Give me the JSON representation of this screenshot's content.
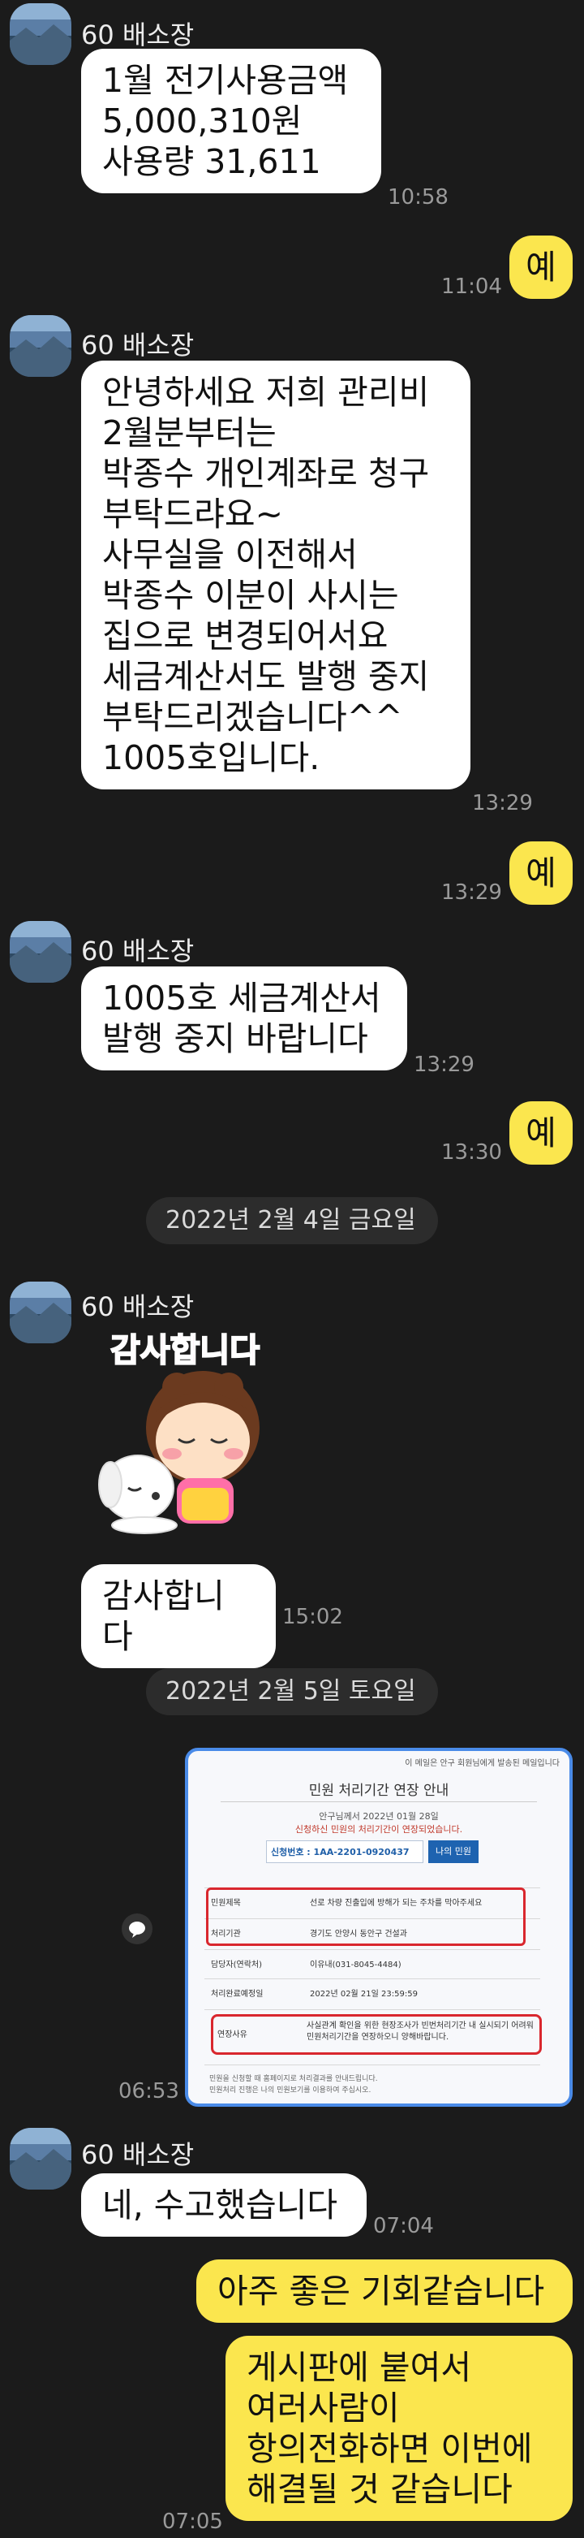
{
  "sender": "60 배소장",
  "messages": [
    {
      "text": "1월 전기사용금액\n5,000,310원\n사용량 31,611",
      "time": "10:58"
    },
    {
      "text": "예",
      "time": "11:04"
    },
    {
      "text": "안녕하세요 저희 관리비\n2월분부터는\n박종수 개인계좌로 청구\n부탁드랴요~\n사무실을 이전해서\n박종수 이분이 사시는\n집으로 변경되어서요\n세금계산서도 발행 중지\n부탁드리겠습니다^^\n1005호입니다.",
      "time": "13:29"
    },
    {
      "text": "예",
      "time": "13:29"
    },
    {
      "text": "1005호 세금계산서\n발행 중지 바랍니다",
      "time": "13:29"
    },
    {
      "text": "예",
      "time": "13:30"
    },
    {
      "text": "감사합니다",
      "time": "15:02"
    },
    {
      "text": "네,  수고했습니다",
      "time": "07:04"
    },
    {
      "text": "아주 좋은 기회같습니다",
      "time": ""
    },
    {
      "text": "게시판에 붙여서\n여러사람이\n항의전화하면 이번에\n해결될 것 같습니다",
      "time": "07:05"
    }
  ],
  "dates": [
    "2022년 2월 4일 금요일",
    "2022년 2월 5일 토요일"
  ],
  "sticker": {
    "caption": "감사합니다"
  },
  "image_msg": {
    "time": "06:53",
    "header": "이 메일은 안구 회원님에게 발송된 메일입니다",
    "title": "민원 처리기간 연장 안내",
    "line1": "안구님께서 2022년 01월 28일",
    "line2": "신청하신 민원의 처리기간이 연장되었습니다.",
    "apply_label": "신청번호 : 1AA-2201-0920437",
    "my_button": "나의 민원",
    "rows": [
      {
        "label": "민원제목",
        "value": "선로 차량 진출입에 방해가 되는 주차를 막아주세요"
      },
      {
        "label": "처리기관",
        "value": "경기도 안양시 동안구 건설과"
      },
      {
        "label": "담당자(연락처)",
        "value": "이유내(031-8045-4484)"
      },
      {
        "label": "처리완료예정일",
        "value": "2022년 02월 21일 23:59:59"
      },
      {
        "label": "연장사유",
        "value": "사실관계 확인을 위한 현장조사가 빈번처리기간 내 실시되기 어려워 민원처리기간을 연장하오니 양해바랍니다."
      }
    ],
    "footer1": "민원을 신청할 때 홈페이지로 처리결과를 안내드립니다.",
    "footer2": "민원처리 진행은 나의 민원보기를 이용하여 주십시오."
  },
  "colors": {
    "background": "#1b1b1b",
    "incoming": "#ffffff",
    "outgoing": "#fbe64e"
  }
}
